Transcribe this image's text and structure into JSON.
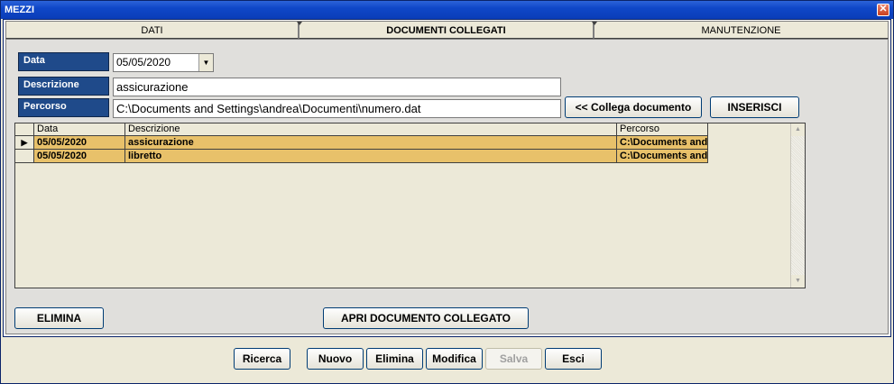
{
  "window": {
    "title": "MEZZI",
    "close_glyph": "✕"
  },
  "tabs": [
    {
      "label": "DATI"
    },
    {
      "label": "DOCUMENTI COLLEGATI",
      "active": true
    },
    {
      "label": "MANUTENZIONE"
    }
  ],
  "form": {
    "data_label": "Data",
    "data_value": "05/05/2020",
    "descrizione_label": "Descrizione",
    "descrizione_value": "assicurazione",
    "percorso_label": "Percorso",
    "percorso_value": "C:\\Documents and Settings\\andrea\\Documenti\\numero.dat",
    "collega_button": "<< Collega documento",
    "inserisci_button": "INSERISCI"
  },
  "table": {
    "columns": [
      "Data",
      "Descrizione",
      "Percorso"
    ],
    "rows": [
      {
        "data": "05/05/2020",
        "descrizione": "assicurazione",
        "percorso": "C:\\Documents and"
      },
      {
        "data": "05/05/2020",
        "descrizione": "libretto",
        "percorso": "C:\\Documents and"
      }
    ],
    "current_row_marker": "▶"
  },
  "panel_buttons": {
    "elimina": "ELIMINA",
    "apri": "APRI DOCUMENTO COLLEGATO"
  },
  "toolbar": {
    "ricerca": "Ricerca",
    "nuovo": "Nuovo",
    "elimina": "Elimina",
    "modifica": "Modifica",
    "salva": "Salva",
    "esci": "Esci"
  },
  "icons": {
    "combo_arrow": "▼",
    "scroll_up": "▲",
    "scroll_down": "▼"
  },
  "colors": {
    "title_bar": "#0a3db8",
    "label_bg": "#1f4a8a",
    "row_highlight": "#e8c16a"
  }
}
